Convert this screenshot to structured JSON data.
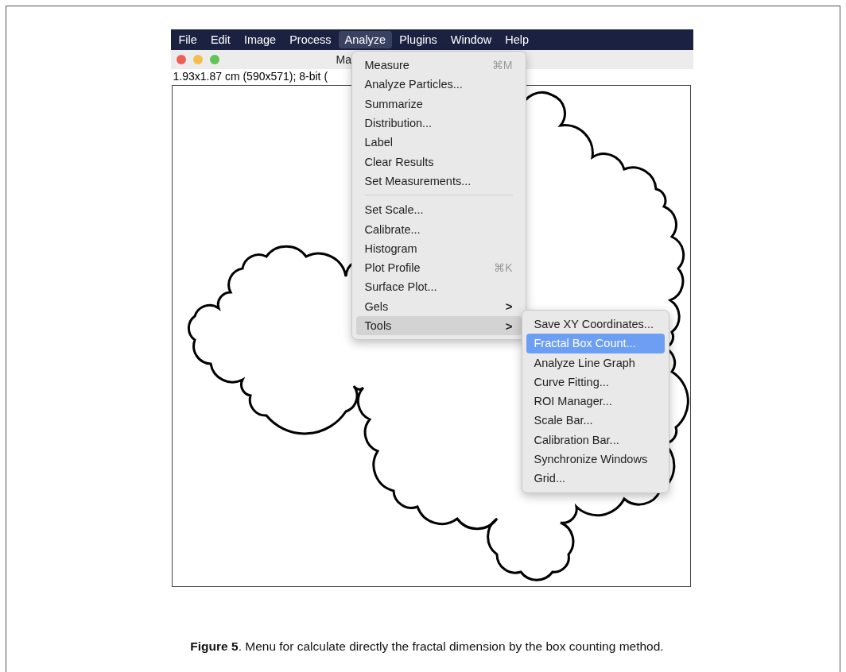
{
  "menu_bar": {
    "items": [
      {
        "label": "File",
        "selected": false
      },
      {
        "label": "Edit",
        "selected": false
      },
      {
        "label": "Image",
        "selected": false
      },
      {
        "label": "Process",
        "selected": false
      },
      {
        "label": "Analyze",
        "selected": true
      },
      {
        "label": "Plugins",
        "selected": false
      },
      {
        "label": "Window",
        "selected": false
      },
      {
        "label": "Help",
        "selected": false
      }
    ]
  },
  "window": {
    "title": "Ma",
    "info": "1.93x1.87 cm (590x571); 8-bit ("
  },
  "menu": {
    "items": [
      {
        "kind": "item",
        "label": "Measure",
        "shortcut": "⌘M",
        "selected": false
      },
      {
        "kind": "item",
        "label": "Analyze Particles...",
        "selected": false
      },
      {
        "kind": "item",
        "label": "Summarize",
        "selected": false
      },
      {
        "kind": "item",
        "label": "Distribution...",
        "selected": false
      },
      {
        "kind": "item",
        "label": "Label",
        "selected": false
      },
      {
        "kind": "item",
        "label": "Clear Results",
        "selected": false
      },
      {
        "kind": "item",
        "label": "Set Measurements...",
        "selected": false
      },
      {
        "kind": "separator"
      },
      {
        "kind": "item",
        "label": "Set Scale...",
        "selected": false
      },
      {
        "kind": "item",
        "label": "Calibrate...",
        "selected": false
      },
      {
        "kind": "item",
        "label": "Histogram",
        "selected": false
      },
      {
        "kind": "item",
        "label": "Plot Profile",
        "shortcut": "⌘K",
        "selected": false
      },
      {
        "kind": "item",
        "label": "Surface Plot...",
        "selected": false
      },
      {
        "kind": "submenu",
        "label": "Gels",
        "arrow": ">",
        "selected": false
      },
      {
        "kind": "submenu",
        "label": "Tools",
        "arrow": ">",
        "selected": true
      }
    ]
  },
  "submenu": {
    "items": [
      {
        "label": "Save XY Coordinates...",
        "selected": false
      },
      {
        "label": "Fractal Box Count...",
        "selected": true
      },
      {
        "label": "Analyze Line Graph",
        "selected": false
      },
      {
        "label": "Curve Fitting...",
        "selected": false
      },
      {
        "label": "ROI Manager...",
        "selected": false
      },
      {
        "label": "Scale Bar...",
        "selected": false
      },
      {
        "label": "Calibration Bar...",
        "selected": false
      },
      {
        "label": "Synchronize Windows",
        "selected": false
      },
      {
        "label": "Grid...",
        "selected": false
      }
    ]
  },
  "caption": "**Figure 5**. Menu for calculate directly the fractal dimension by the box counting method."
}
